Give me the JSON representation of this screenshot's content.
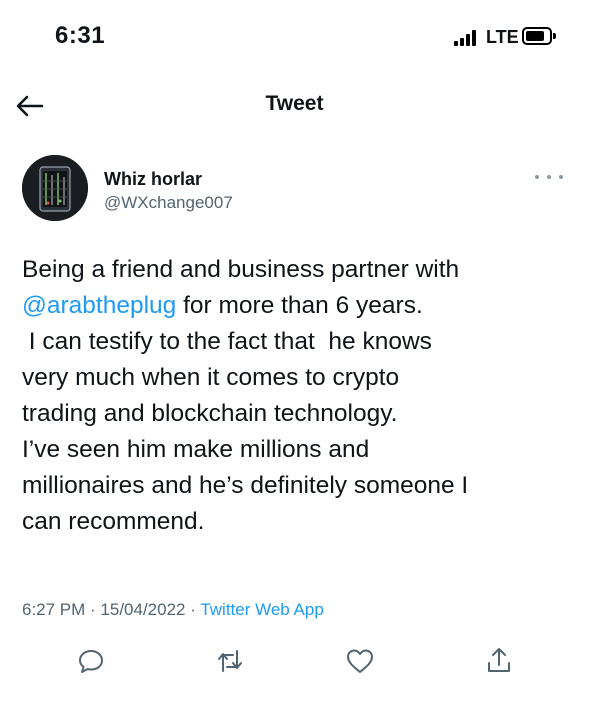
{
  "status_bar": {
    "time": "6:31",
    "network": "LTE"
  },
  "nav": {
    "back_icon": "arrow-left-icon",
    "title": "Tweet"
  },
  "author": {
    "display_name": "Whiz horlar",
    "handle": "@WXchange007",
    "more_icon": "more-icon"
  },
  "tweet": {
    "lines": [
      {
        "pre": "Being a friend and business partner with",
        "mention": "",
        "post": ""
      },
      {
        "pre": "",
        "mention": "@arabtheplug",
        "post": " for more than 6 years."
      },
      {
        "pre": " I can testify to the fact that  he knows",
        "mention": "",
        "post": ""
      },
      {
        "pre": "very much when it comes to crypto",
        "mention": "",
        "post": ""
      },
      {
        "pre": "trading and blockchain technology.",
        "mention": "",
        "post": ""
      },
      {
        "pre": "I’ve seen him make millions and",
        "mention": "",
        "post": ""
      },
      {
        "pre": "millionaires and he’s definitely someone I",
        "mention": "",
        "post": ""
      },
      {
        "pre": "can recommend.",
        "mention": "",
        "post": ""
      }
    ]
  },
  "meta": {
    "time": "6:27 PM",
    "separator": " · ",
    "date": "15/04/2022",
    "source": "Twitter Web App"
  },
  "actions": [
    {
      "icon": "reply-icon"
    },
    {
      "icon": "retweet-icon"
    },
    {
      "icon": "like-icon"
    },
    {
      "icon": "share-icon"
    }
  ],
  "colors": {
    "accent": "#1d9bf0",
    "text": "#0f1419",
    "secondary": "#536471"
  }
}
